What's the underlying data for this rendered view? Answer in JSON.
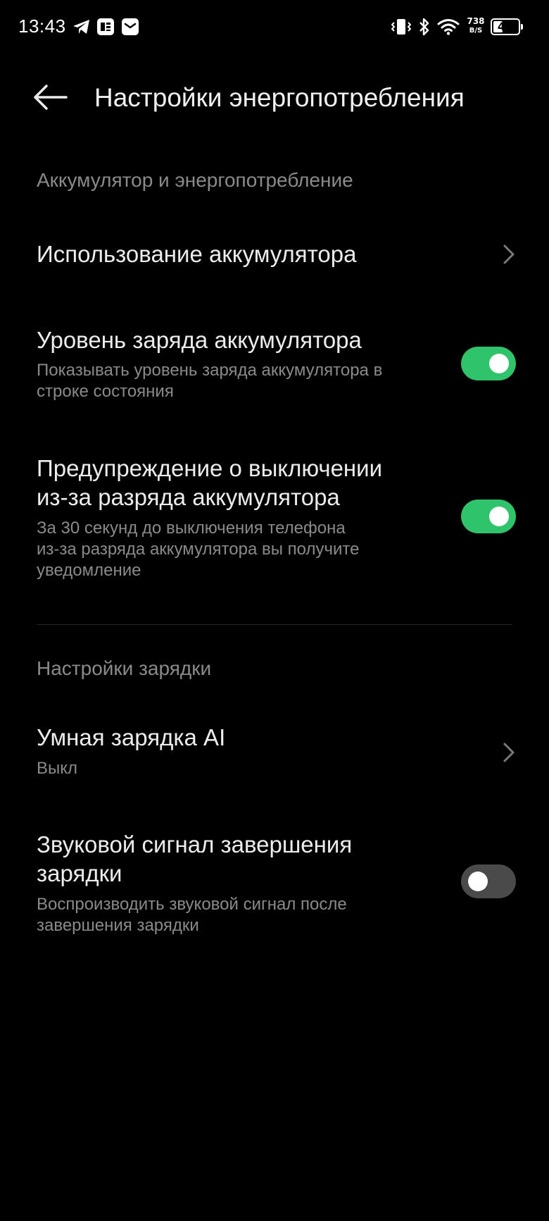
{
  "status_bar": {
    "time": "13:43",
    "icons": [
      "telegram-icon",
      "news-app-icon",
      "mail-icon",
      "vibrate-icon",
      "bluetooth-icon",
      "wifi-icon"
    ],
    "net_speed_value": "738",
    "net_speed_unit": "B/S",
    "battery_level": "46",
    "battery_percent": 46
  },
  "header": {
    "back_icon": "arrow-left-icon",
    "title": "Настройки энергопотребления"
  },
  "sections": {
    "battery": {
      "header": "Аккумулятор и энергопотребление",
      "usage": {
        "title": "Использование аккумулятора",
        "icon": "chevron-right-icon"
      },
      "level": {
        "title": "Уровень заряда аккумулятора",
        "subtitle_line1": "Показывать уровень заряда аккумулятора в",
        "subtitle_line2": "строке состояния",
        "enabled": true
      },
      "warning": {
        "title_line1": "Предупреждение о выключении",
        "title_line2": "из-за разряда аккумулятора",
        "subtitle_line1": "За 30 секунд до выключения телефона",
        "subtitle_line2": "из-за разряда аккумулятора вы получите",
        "subtitle_line3": "уведомление",
        "enabled": true
      }
    },
    "charging": {
      "header": "Настройки зарядки",
      "smart": {
        "title": "Умная зарядка AI",
        "subtitle": "Выкл",
        "icon": "chevron-right-icon"
      },
      "sound": {
        "title_line1": "Звуковой сигнал завершения",
        "title_line2": "зарядки",
        "subtitle_line1": "Воспроизводить звуковой сигнал после",
        "subtitle_line2": "завершения зарядки",
        "enabled": false
      }
    }
  },
  "colors": {
    "background": "#000000",
    "toggle_on": "#2fc36b",
    "toggle_off": "#4a4a4a",
    "primary_text": "#ececec",
    "secondary_text": "#8a8a8a"
  }
}
